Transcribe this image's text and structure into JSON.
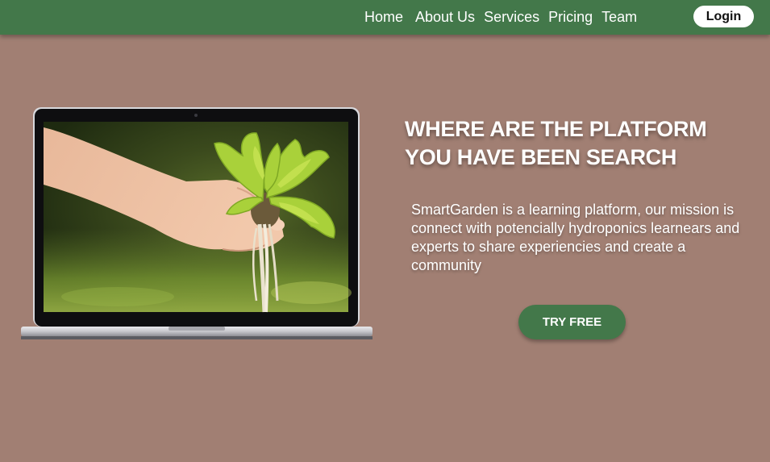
{
  "nav": {
    "items": [
      {
        "label": "Home"
      },
      {
        "label": "About Us"
      },
      {
        "label": "Services"
      },
      {
        "label": "Pricing"
      },
      {
        "label": "Team"
      }
    ],
    "login_label": "Login"
  },
  "hero": {
    "headline": "WHERE ARE THE PLATFORM YOU HAVE BEEN SEARCH",
    "description": "SmartGarden is a learning platform, our mission is connect with potencially hydroponics learnears and experts to share experiencies and create a community",
    "cta_label": "TRY FREE",
    "image": "laptop-with-hand-holding-lettuce-seedling"
  },
  "colors": {
    "background": "#a17f73",
    "navbar": "#43784a",
    "button": "#43784a",
    "text": "#ffffff"
  }
}
